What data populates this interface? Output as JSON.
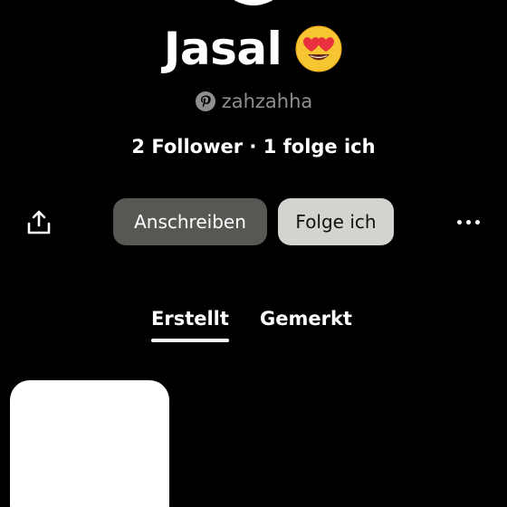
{
  "profile": {
    "display_name": "Jasal",
    "name_emoji_icon": "heart-eyes-emoji-icon",
    "handle": "zahzahha",
    "handle_icon": "pinterest-icon",
    "followers_text": "2 Follower",
    "separator": " · ",
    "following_text": "1 folge ich"
  },
  "actions": {
    "share_icon": "share-icon",
    "message_label": "Anschreiben",
    "follow_label": "Folge ich",
    "more_icon": "more-options-icon"
  },
  "tabs": [
    {
      "label": "Erstellt",
      "active": true
    },
    {
      "label": "Gemerkt",
      "active": false
    }
  ],
  "colors": {
    "background": "#000000",
    "message_button": "#575754",
    "follow_button": "#d3d3cf",
    "muted_text": "#8e8e8e"
  }
}
